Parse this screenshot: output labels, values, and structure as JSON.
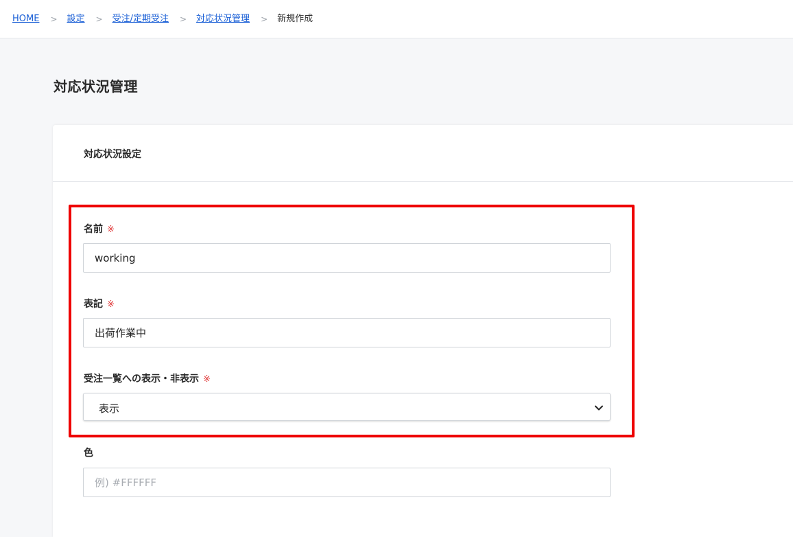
{
  "breadcrumb": {
    "items": [
      "HOME",
      "設定",
      "受注/定期受注",
      "対応状況管理"
    ],
    "separator": ">",
    "current": "新規作成"
  },
  "page": {
    "title": "対応状況管理"
  },
  "card": {
    "title": "対応状況設定"
  },
  "form": {
    "required_mark": "※",
    "name": {
      "label": "名前",
      "value": "working"
    },
    "notation": {
      "label": "表記",
      "value": "出荷作業中"
    },
    "display": {
      "label": "受注一覧への表示・非表示",
      "selected": "表示"
    },
    "color": {
      "label": "色",
      "value": "",
      "placeholder": "例) #FFFFFF"
    }
  },
  "colors": {
    "link": "#1a5fd6",
    "required": "#e03c3c",
    "highlight_border": "#ee0000"
  },
  "icons": {
    "select_arrow": "chevron-down-icon"
  }
}
